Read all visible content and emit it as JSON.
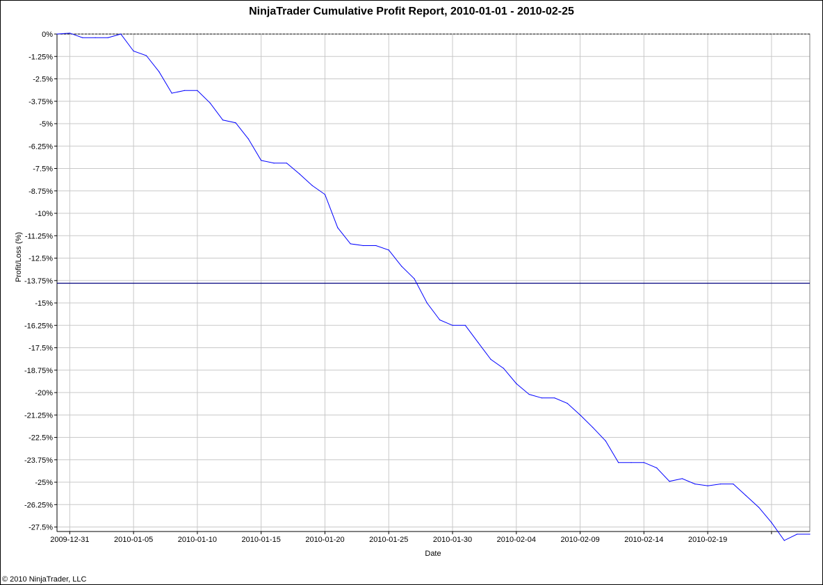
{
  "page": {
    "title": "NinjaTrader Cumulative Profit Report, 2010-01-01 - 2010-02-25",
    "copyright": "© 2010 NinjaTrader, LLC"
  },
  "colors": {
    "series": "#0000ff",
    "reference_line": "#00007f",
    "grid": "#c8c8c8",
    "zero_line": "#000000"
  },
  "chart_data": {
    "type": "line",
    "title": "NinjaTrader Cumulative Profit Report, 2010-01-01 - 2010-02-25",
    "xlabel": "Date",
    "ylabel": "Profit/Loss (%)",
    "xlim": [
      "2009-12-30",
      "2010-02-27"
    ],
    "ylim": [
      -27.75,
      0
    ],
    "grid": true,
    "legend": "none",
    "x_ticks": [
      "2009-12-31",
      "2010-01-05",
      "2010-01-10",
      "2010-01-15",
      "2010-01-20",
      "2010-01-25",
      "2010-01-30",
      "2010-02-04",
      "2010-02-09",
      "2010-02-14",
      "2010-02-19",
      "2010-02-24"
    ],
    "x_tick_labels": [
      "2009-12-31",
      "2010-01-05",
      "2010-01-10",
      "2010-01-15",
      "2010-01-20",
      "2010-01-25",
      "2010-01-30",
      "2010-02-04",
      "2010-02-09",
      "2010-02-14",
      "2010-02-19",
      ""
    ],
    "y_ticks": [
      0,
      -1.25,
      -2.5,
      -3.75,
      -5,
      -6.25,
      -7.5,
      -8.75,
      -10,
      -11.25,
      -12.5,
      -13.75,
      -15,
      -16.25,
      -17.5,
      -18.75,
      -20,
      -21.25,
      -22.5,
      -23.75,
      -25,
      -26.25,
      -27.5
    ],
    "y_tick_labels": [
      "0%",
      "-1.25%",
      "-2.5%",
      "-3.75%",
      "-5%",
      "-6.25%",
      "-7.5%",
      "-8.75%",
      "-10%",
      "-11.25%",
      "-12.5%",
      "-13.75%",
      "-15%",
      "-16.25%",
      "-17.5%",
      "-18.75%",
      "-20%",
      "-21.25%",
      "-22.5%",
      "-23.75%",
      "-25%",
      "-26.25%",
      "-27.5%"
    ],
    "reference_lines": [
      {
        "y": 0,
        "style": "dashed"
      },
      {
        "y": -13.9,
        "style": "solid"
      }
    ],
    "series": [
      {
        "x": [
          "2009-12-30",
          "2009-12-31",
          "2010-01-01",
          "2010-01-02",
          "2010-01-03",
          "2010-01-04",
          "2010-01-05",
          "2010-01-06",
          "2010-01-07",
          "2010-01-08",
          "2010-01-09",
          "2010-01-10",
          "2010-01-11",
          "2010-01-12",
          "2010-01-13",
          "2010-01-14",
          "2010-01-15",
          "2010-01-16",
          "2010-01-17",
          "2010-01-18",
          "2010-01-19",
          "2010-01-20",
          "2010-01-21",
          "2010-01-22",
          "2010-01-23",
          "2010-01-24",
          "2010-01-25",
          "2010-01-26",
          "2010-01-27",
          "2010-01-28",
          "2010-01-29",
          "2010-01-30",
          "2010-01-31",
          "2010-02-01",
          "2010-02-02",
          "2010-02-03",
          "2010-02-04",
          "2010-02-05",
          "2010-02-06",
          "2010-02-07",
          "2010-02-08",
          "2010-02-09",
          "2010-02-10",
          "2010-02-11",
          "2010-02-12",
          "2010-02-13",
          "2010-02-14",
          "2010-02-15",
          "2010-02-16",
          "2010-02-17",
          "2010-02-18",
          "2010-02-19",
          "2010-02-20",
          "2010-02-21",
          "2010-02-22",
          "2010-02-23",
          "2010-02-24",
          "2010-02-25",
          "2010-02-26",
          "2010-02-27"
        ],
        "values": [
          0,
          0.05,
          -0.2,
          -0.2,
          -0.2,
          0,
          -0.95,
          -1.2,
          -2.1,
          -3.3,
          -3.15,
          -3.15,
          -3.85,
          -4.8,
          -4.95,
          -5.85,
          -7.05,
          -7.2,
          -7.2,
          -7.8,
          -8.45,
          -8.95,
          -10.8,
          -11.7,
          -11.8,
          -11.8,
          -12.05,
          -12.95,
          -13.65,
          -15,
          -15.95,
          -16.25,
          -16.25,
          -17.2,
          -18.15,
          -18.65,
          -19.5,
          -20.1,
          -20.3,
          -20.3,
          -20.6,
          -21.25,
          -21.95,
          -22.7,
          -23.9,
          -23.9,
          -23.9,
          -24.2,
          -24.95,
          -24.8,
          -25.1,
          -25.2,
          -25.1,
          -25.1,
          -25.75,
          -26.4,
          -27.25,
          -28.25,
          -27.9,
          -27.9
        ]
      }
    ]
  }
}
